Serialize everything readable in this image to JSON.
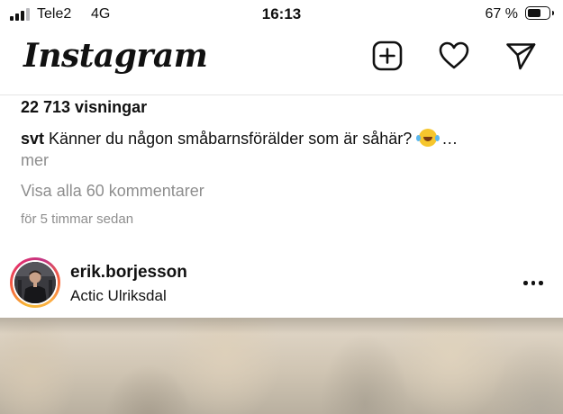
{
  "status_bar": {
    "carrier": "Tele2",
    "network": "4G",
    "time": "16:13",
    "battery_percent": "67 %",
    "battery_level": 0.67,
    "signal_bars": 3,
    "signal_bars_total": 4
  },
  "header": {
    "logo_text": "Instagram",
    "icons": [
      "plus-square-icon",
      "heart-icon",
      "send-icon"
    ]
  },
  "post": {
    "views": "22 713 visningar",
    "caption_user": "svt",
    "caption_text": "Känner du någon småbarnsförälder som är såhär?",
    "caption_emoji": "laughing-tears-emoji",
    "caption_ellipsis": "…",
    "more_label": "mer",
    "comments_link": "Visa alla 60 kommentarer",
    "timestamp": "för 5 timmar sedan"
  },
  "next_post": {
    "username": "erik.borjesson",
    "location": "Actic Ulriksdal",
    "options_icon": "more-horizontal-icon"
  },
  "colors": {
    "text": "#111111",
    "secondary_text": "#8e8e8e",
    "divider": "#e4e4e4"
  }
}
